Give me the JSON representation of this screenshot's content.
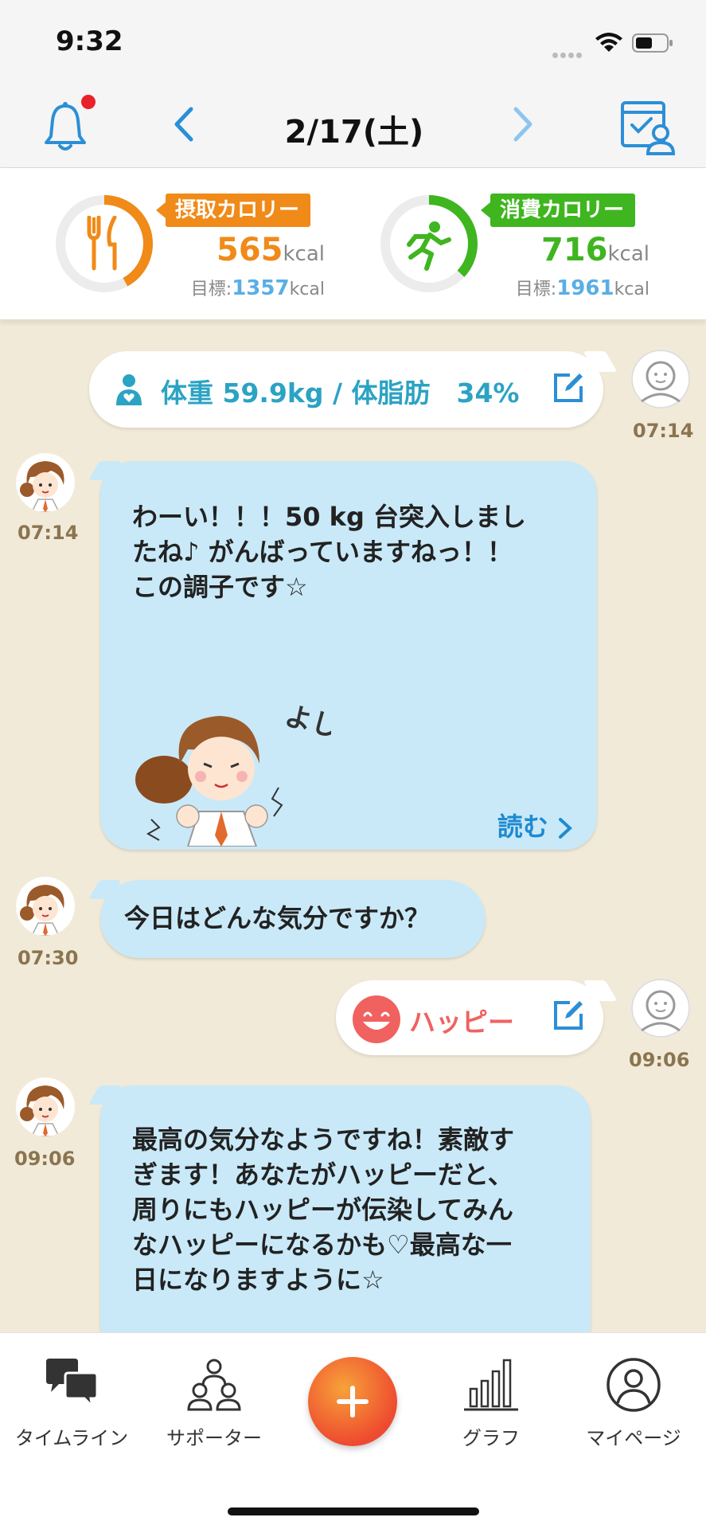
{
  "status": {
    "time": "9:32"
  },
  "header": {
    "date": "2/17(土)"
  },
  "calories": {
    "intake": {
      "label": "摂取カロリー",
      "value": "565",
      "unit": "kcal",
      "goal_label": "目標:",
      "goal_value": "1357",
      "goal_unit": "kcal",
      "color": "#f08a18",
      "progress": 0.42
    },
    "burn": {
      "label": "消費カロリー",
      "value": "716",
      "unit": "kcal",
      "goal_label": "目標:",
      "goal_value": "1961",
      "goal_unit": "kcal",
      "color": "#3fb51f",
      "progress": 0.37
    }
  },
  "timeline": {
    "weight_entry": {
      "text": "体重 59.9kg / 体脂肪　34%",
      "time": "07:14"
    },
    "bot_message_1": {
      "text_lines": [
        "わーい！！！50 kg 台突入しまし",
        "たね♪ がんばっていますねっ！！",
        "この調子です☆"
      ],
      "time": "07:14",
      "read_more": "読む",
      "sticker_text": "よしっ"
    },
    "bot_message_2": {
      "text": "今日はどんな気分ですか？",
      "time": "07:30"
    },
    "mood_entry": {
      "text": "ハッピー",
      "time": "09:06"
    },
    "bot_message_3": {
      "text_lines": [
        "最高の気分なようですね！素敵す",
        "ぎます！あなたがハッピーだと、",
        "周りにもハッピーが伝染してみん",
        "なハッピーになるかも♡最高な一",
        "日になりますように☆"
      ],
      "time": "09:06"
    }
  },
  "tabs": [
    {
      "label": "タイムライン",
      "icon": "chat-bubbles-icon"
    },
    {
      "label": "サポーター",
      "icon": "supporters-icon"
    },
    {
      "label": "グラフ",
      "icon": "bar-graph-icon"
    },
    {
      "label": "マイページ",
      "icon": "user-circle-icon"
    }
  ],
  "colors": {
    "accent_blue": "#1e8ad0",
    "weight_text": "#2ba3c3",
    "mood_text": "#f0625f",
    "bubble_bot": "#c9e9f8",
    "background": "#f2ead8"
  }
}
